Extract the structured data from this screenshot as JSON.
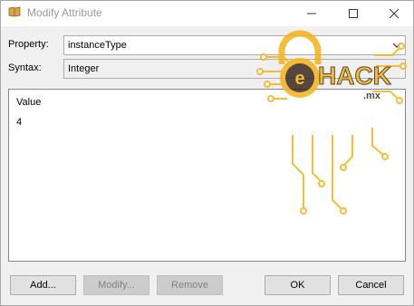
{
  "window": {
    "title": "Modify Attribute",
    "icon": "folder-book-icon"
  },
  "form": {
    "property_label": "Property:",
    "property_value": "instanceType",
    "syntax_label": "Syntax:",
    "syntax_value": "Integer"
  },
  "values": {
    "column_header": "Value",
    "rows": [
      "4"
    ]
  },
  "buttons": {
    "add": "Add...",
    "modify": "Modify...",
    "remove": "Remove",
    "ok": "OK",
    "cancel": "Cancel"
  },
  "watermark": {
    "brand_letter": "e",
    "brand_text": "HACK",
    "brand_suffix": ".mx",
    "accent_color": "#f5b316",
    "dark_color": "#3a2a1e"
  }
}
